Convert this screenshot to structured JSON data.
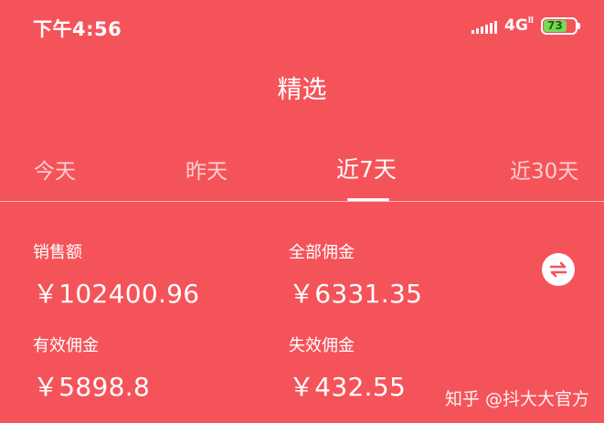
{
  "status_bar": {
    "time": "下午4:56",
    "network": "4G",
    "network_sub": "ll",
    "battery": "73"
  },
  "header": {
    "title": "精选"
  },
  "tabs": [
    {
      "label": "今天",
      "active": false
    },
    {
      "label": "昨天",
      "active": false
    },
    {
      "label": "近7天",
      "active": true
    },
    {
      "label": "近30天",
      "active": false
    }
  ],
  "metrics": {
    "sales": {
      "label": "销售额",
      "value": "￥102400.96"
    },
    "total_commission": {
      "label": "全部佣金",
      "value": "￥6331.35"
    },
    "valid_commission": {
      "label": "有效佣金",
      "value": "￥5898.8"
    },
    "invalid_commission": {
      "label": "失效佣金",
      "value": "￥432.55"
    }
  },
  "watermark": "知乎 @抖大大官方",
  "colors": {
    "background": "#f5535a",
    "battery_fill": "#79d957"
  }
}
